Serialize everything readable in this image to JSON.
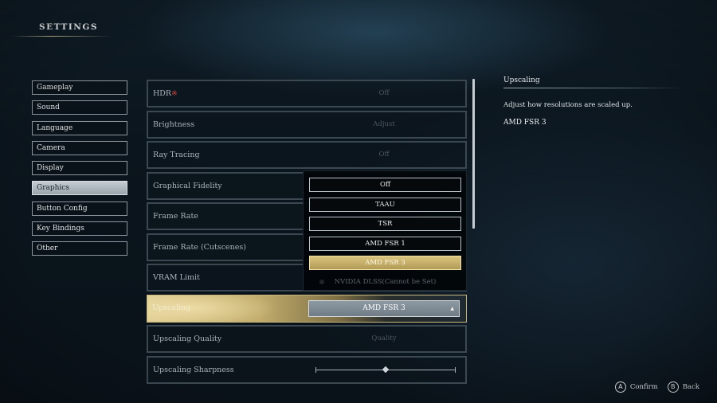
{
  "header": {
    "title": "SETTINGS"
  },
  "sidebar": {
    "items": [
      {
        "label": "Gameplay",
        "active": false
      },
      {
        "label": "Sound",
        "active": false
      },
      {
        "label": "Language",
        "active": false
      },
      {
        "label": "Camera",
        "active": false
      },
      {
        "label": "Display",
        "active": false
      },
      {
        "label": "Graphics",
        "active": true
      },
      {
        "label": "Button Config",
        "active": false
      },
      {
        "label": "Key Bindings",
        "active": false
      },
      {
        "label": "Other",
        "active": false
      }
    ]
  },
  "settings": {
    "hdr": {
      "label": "HDR",
      "mark": "※",
      "value": "Off"
    },
    "brightness": {
      "label": "Brightness",
      "value": "Adjust"
    },
    "ray_tracing": {
      "label": "Ray Tracing",
      "value": "Off"
    },
    "graphical_fidelity": {
      "label": "Graphical Fidelity"
    },
    "frame_rate": {
      "label": "Frame Rate"
    },
    "frame_rate_cutscenes": {
      "label": "Frame Rate (Cutscenes)"
    },
    "vram_limit": {
      "label": "VRAM Limit"
    },
    "upscaling": {
      "label": "Upscaling",
      "value": "AMD FSR 3",
      "caret": "▲"
    },
    "upscaling_quality": {
      "label": "Upscaling Quality",
      "value": "Quality"
    },
    "upscaling_sharpness": {
      "label": "Upscaling Sharpness",
      "level": 0.5
    }
  },
  "dropdown": {
    "options": [
      {
        "label": "Off",
        "state": "normal"
      },
      {
        "label": "TAAU",
        "state": "normal"
      },
      {
        "label": "TSR",
        "state": "normal"
      },
      {
        "label": "AMD FSR 1",
        "state": "normal"
      },
      {
        "label": "AMD FSR 3",
        "state": "selected"
      },
      {
        "label": "NVIDIA DLSS(Cannot be Set)",
        "state": "disabled"
      }
    ]
  },
  "info": {
    "title": "Upscaling",
    "description": "Adjust how resolutions are scaled up.",
    "value": "AMD FSR 3"
  },
  "prompts": {
    "confirm": {
      "glyph": "A",
      "label": "Confirm"
    },
    "back": {
      "glyph": "B",
      "label": "Back"
    }
  },
  "colors": {
    "selected_gold": "#c9b87e",
    "hdr_mark": "#e0483c",
    "panel_border": "#3b4852"
  }
}
